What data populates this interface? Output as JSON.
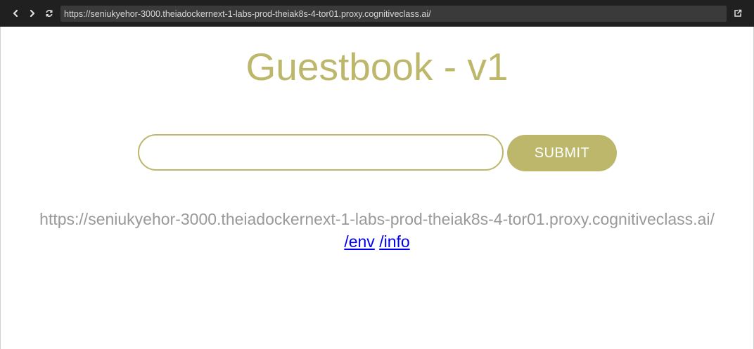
{
  "browser": {
    "url": "https://seniukyehor-3000.theiadockernext-1-labs-prod-theiak8s-4-tor01.proxy.cognitiveclass.ai/",
    "icons": [
      "chevron-left-icon",
      "chevron-right-icon",
      "refresh-icon",
      "open-external-icon"
    ]
  },
  "page": {
    "title": "Guestbook - v1",
    "entry": {
      "value": "",
      "placeholder": ""
    },
    "submit_label": "SUBMIT",
    "host_text": "https://seniukyehor-3000.theiadockernext-1-labs-prod-theiak8s-4-tor01.proxy.cognitiveclass.ai/",
    "links": [
      {
        "label": "/env"
      },
      {
        "label": "/info"
      }
    ]
  },
  "colors": {
    "accent": "#bdb76b",
    "browser_bar": "#202020",
    "url_field": "#3a3a3a",
    "host_text": "#999999",
    "link": "#0000ee"
  }
}
